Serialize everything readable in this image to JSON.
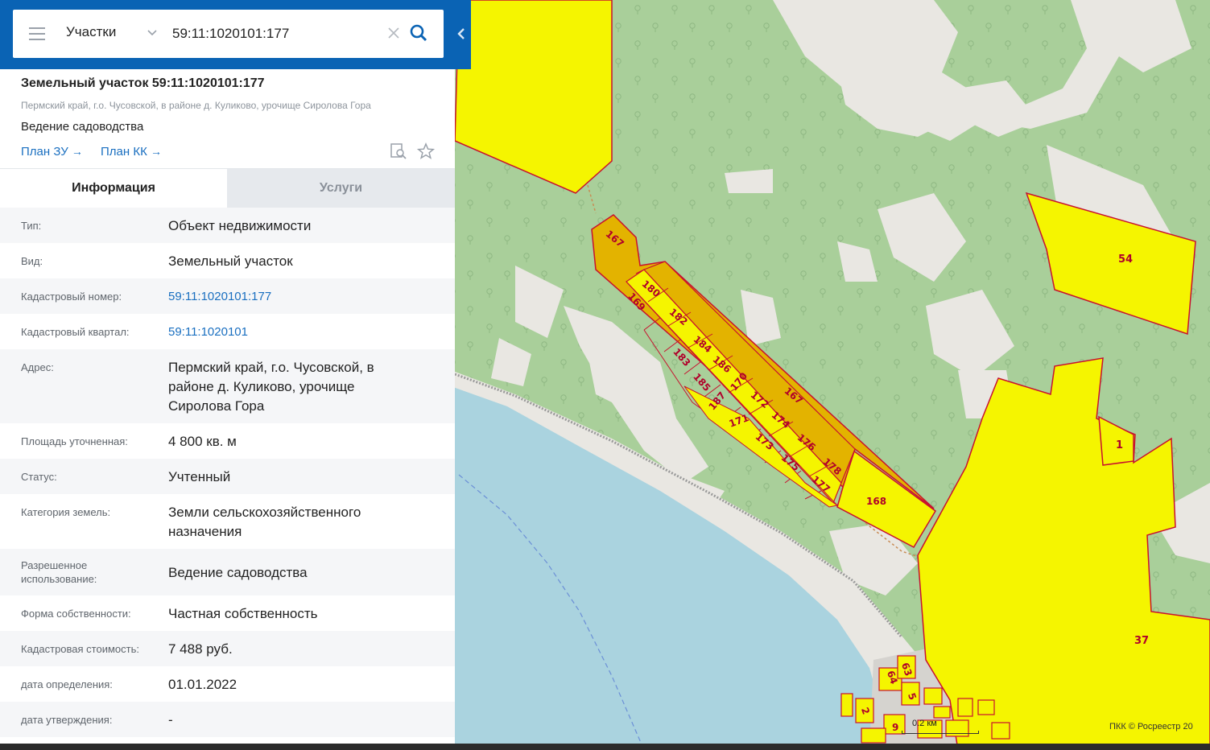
{
  "search": {
    "layer": "Участки",
    "query": "59:11:1020101:177"
  },
  "card": {
    "title": "Земельный участок 59:11:1020101:177",
    "address": "Пермский край, г.о. Чусовской, в районе д. Куликово, урочище Сиролова Гора",
    "purpose": "Ведение садоводства",
    "plan_zu": "План ЗУ",
    "plan_kk": "План КК"
  },
  "tabs": [
    {
      "label": "Информация",
      "active": true
    },
    {
      "label": "Услуги",
      "active": false
    }
  ],
  "info_rows": [
    {
      "label": "Тип:",
      "value": "Объект недвижимости"
    },
    {
      "label": "Вид:",
      "value": "Земельный участок"
    },
    {
      "label": "Кадастровый номер:",
      "value": "59:11:1020101:177",
      "link": true
    },
    {
      "label": "Кадастровый квартал:",
      "value": "59:11:1020101",
      "link": true
    },
    {
      "label": "Адрес:",
      "value": "Пермский край, г.о. Чусовской, в районе д. Куликово, урочище Сиролова Гора"
    },
    {
      "label": "Площадь уточненная:",
      "value": "4 800 кв. м"
    },
    {
      "label": "Статус:",
      "value": "Учтенный"
    },
    {
      "label": "Категория земель:",
      "value": "Земли сельскохозяйственного назначения"
    },
    {
      "label": "Разрешенное использование:",
      "value": "Ведение садоводства"
    },
    {
      "label": "Форма собственности:",
      "value": "Частная собственность"
    },
    {
      "label": "Кадастровая стоимость:",
      "value": "7 488 руб."
    },
    {
      "label": "дата определения:",
      "value": "01.01.2022"
    },
    {
      "label": "дата утверждения:",
      "value": "-"
    }
  ],
  "map": {
    "plots": [
      "167",
      "180",
      "169",
      "182",
      "184",
      "183",
      "186",
      "170",
      "185",
      "187",
      "172",
      "167",
      "174",
      "171",
      "173",
      "176",
      "175",
      "178",
      "177",
      "168",
      "54",
      "1",
      "37",
      "63",
      "64",
      "5",
      "2",
      "9"
    ],
    "scale": "0.2 км",
    "credit": "ПКК © Росреестр 20",
    "colors": {
      "forest": "#a9cf9a",
      "meadow": "#e9e7e2",
      "water": "#aad3df",
      "plot": "#f5f500",
      "selected": "#e3b300",
      "border": "#c8102e"
    }
  }
}
